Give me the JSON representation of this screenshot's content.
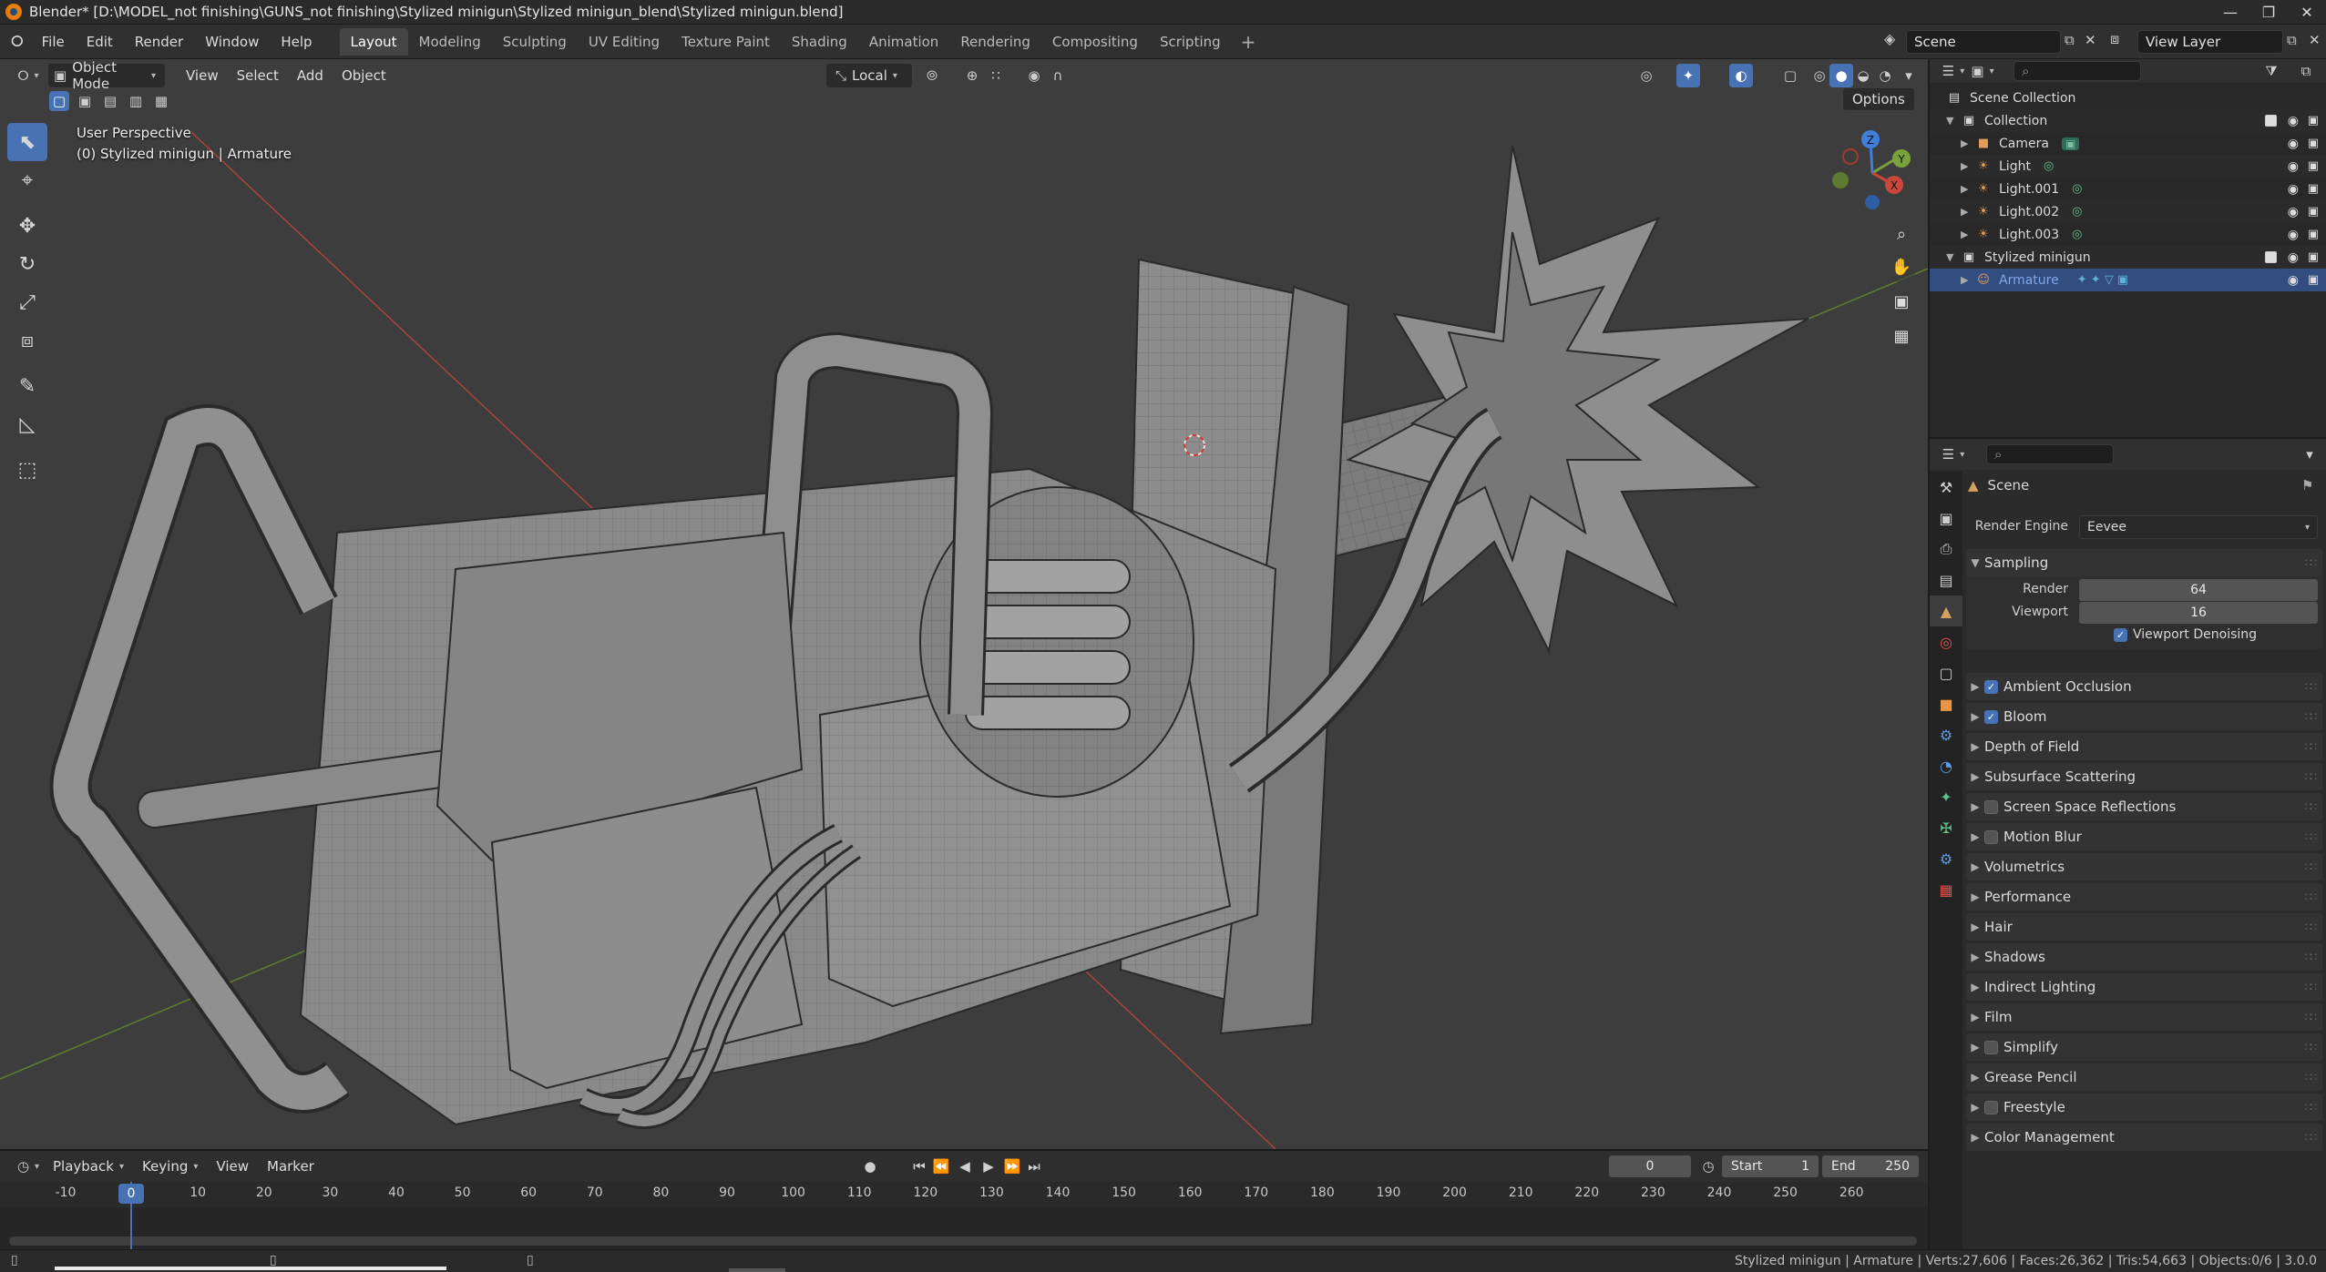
{
  "window": {
    "title": "Blender* [D:\\MODEL_not finishing\\GUNS_not finishing\\Stylized minigun\\Stylized minigun_blend\\Stylized minigun.blend]",
    "minimize": "—",
    "restore": "❐",
    "close": "✕"
  },
  "menus": [
    "File",
    "Edit",
    "Render",
    "Window",
    "Help"
  ],
  "workspaces": [
    "Layout",
    "Modeling",
    "Sculpting",
    "UV Editing",
    "Texture Paint",
    "Shading",
    "Animation",
    "Rendering",
    "Compositing",
    "Scripting"
  ],
  "active_workspace": "Layout",
  "scene_field": "Scene",
  "view_layer_field": "View Layer",
  "viewport_header": {
    "mode": "Object Mode",
    "menus": [
      "View",
      "Select",
      "Add",
      "Object"
    ],
    "transform_orientation": "Local",
    "options": "Options"
  },
  "viewport_overlay": {
    "perspective": "User Perspective",
    "object_info": "(0) Stylized minigun | Armature"
  },
  "gizmo_axes": {
    "x": "X",
    "y": "Y",
    "z": "Z"
  },
  "timeline": {
    "menus": [
      "Playback",
      "Keying",
      "View",
      "Marker"
    ],
    "current_frame": "0",
    "start_label": "Start",
    "start": "1",
    "end_label": "End",
    "end": "250",
    "ticks": [
      "-10",
      "0",
      "10",
      "20",
      "30",
      "40",
      "50",
      "60",
      "70",
      "80",
      "90",
      "100",
      "110",
      "120",
      "130",
      "140",
      "150",
      "160",
      "170",
      "180",
      "190",
      "200",
      "210",
      "220",
      "230",
      "240",
      "250",
      "260"
    ]
  },
  "status": "Stylized minigun | Armature | Verts:27,606 | Faces:26,362 | Tris:54,663 | Objects:0/6 | 3.0.0",
  "outliner": {
    "rows": [
      {
        "label": "Scene Collection",
        "type": "scene"
      },
      {
        "label": "Collection",
        "type": "collection"
      },
      {
        "label": "Camera",
        "type": "camera"
      },
      {
        "label": "Light",
        "type": "light"
      },
      {
        "label": "Light.001",
        "type": "light"
      },
      {
        "label": "Light.002",
        "type": "light"
      },
      {
        "label": "Light.003",
        "type": "light"
      },
      {
        "label": "Stylized minigun",
        "type": "collection"
      },
      {
        "label": "Armature",
        "type": "armature"
      }
    ]
  },
  "properties": {
    "context": "Scene",
    "render_engine_label": "Render Engine",
    "render_engine": "Eevee",
    "sampling": {
      "title": "Sampling",
      "render_label": "Render",
      "render": "64",
      "viewport_label": "Viewport",
      "viewport": "16",
      "denoise": "Viewport Denoising"
    },
    "panels": [
      {
        "label": "Ambient Occlusion",
        "checkbox": "on"
      },
      {
        "label": "Bloom",
        "checkbox": "on"
      },
      {
        "label": "Depth of Field",
        "checkbox": "none"
      },
      {
        "label": "Subsurface Scattering",
        "checkbox": "none"
      },
      {
        "label": "Screen Space Reflections",
        "checkbox": "off"
      },
      {
        "label": "Motion Blur",
        "checkbox": "off"
      },
      {
        "label": "Volumetrics",
        "checkbox": "none"
      },
      {
        "label": "Performance",
        "checkbox": "none"
      },
      {
        "label": "Hair",
        "checkbox": "none"
      },
      {
        "label": "Shadows",
        "checkbox": "none"
      },
      {
        "label": "Indirect Lighting",
        "checkbox": "none"
      },
      {
        "label": "Film",
        "checkbox": "none"
      },
      {
        "label": "Simplify",
        "checkbox": "off"
      },
      {
        "label": "Grease Pencil",
        "checkbox": "none"
      },
      {
        "label": "Freestyle",
        "checkbox": "off"
      },
      {
        "label": "Color Management",
        "checkbox": "none"
      }
    ]
  },
  "colors": {
    "accent": "#4772b3",
    "viewport_bg": "#3d3d3d",
    "x_axis": "#c8473a",
    "y_axis": "#7aa23b",
    "z_axis": "#3f7fd9",
    "model": "#8a8a8a"
  }
}
